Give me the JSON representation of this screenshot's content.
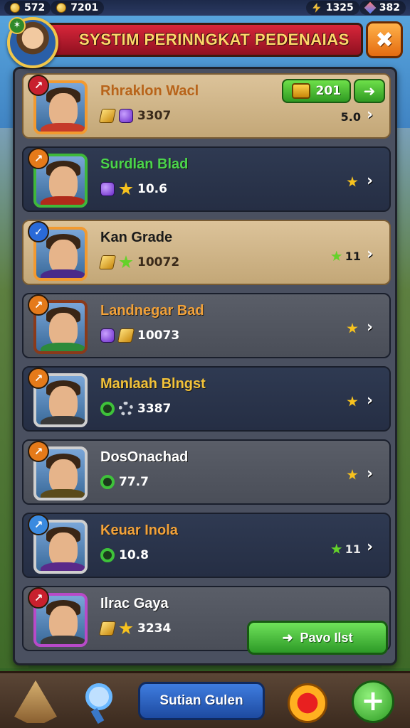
{
  "status_bar": {
    "left_coin_value": "572",
    "coins_value": "7201",
    "bolt_value": "1325",
    "gems_value": "382"
  },
  "header": {
    "title": "SYSTIM PERINNGKAT PEDENAIAS",
    "close_icon": "✖"
  },
  "leaderboard": {
    "top_reward": {
      "value": "201",
      "arrow": "➜"
    },
    "rows": [
      {
        "name": "Rhraklon Wacl",
        "name_color": "#b8641a",
        "stat_value": "3307",
        "right_value": "5.0",
        "style": "gold",
        "badge_color": "#c8202e",
        "frame_color": "#f29a30",
        "body_color": "#c53a2a",
        "badge_glyph": "↗"
      },
      {
        "name": "Surdlan Blad",
        "name_color": "#4bd54b",
        "stat_value": "10.6",
        "right_value": "",
        "style": "dark",
        "badge_color": "#e57a1a",
        "frame_color": "#3fb83a",
        "body_color": "#b02a1a",
        "badge_glyph": "↗"
      },
      {
        "name": "Kan Grade",
        "name_color": "#1a1a1a",
        "stat_value": "10072",
        "right_value": "11",
        "style": "gold",
        "badge_color": "#2a6ad8",
        "frame_color": "#f29a30",
        "body_color": "#4a2a8a",
        "badge_glyph": "✓"
      },
      {
        "name": "Landnegar Bad",
        "name_color": "#f2a23a",
        "stat_value": "10073",
        "right_value": "",
        "style": "grey",
        "badge_color": "#e57a1a",
        "frame_color": "#8a3a1a",
        "body_color": "#2d8a3a",
        "badge_glyph": "↗"
      },
      {
        "name": "Manlaah Blngst",
        "name_color": "#f2c23a",
        "stat_value": "3387",
        "right_value": "",
        "style": "dark",
        "badge_color": "#e57a1a",
        "frame_color": "#cfcfcf",
        "body_color": "#3a3a3a",
        "badge_glyph": "↗"
      },
      {
        "name": "DosOnachad",
        "name_color": "#ffffff",
        "stat_value": "77.7",
        "right_value": "",
        "style": "grey",
        "badge_color": "#e57a1a",
        "frame_color": "#cfcfcf",
        "body_color": "#5a4a1a",
        "badge_glyph": "↗"
      },
      {
        "name": "Keuar Inola",
        "name_color": "#f2a23a",
        "stat_value": "10.8",
        "right_value": "11",
        "style": "dark",
        "badge_color": "#3a8ae0",
        "frame_color": "#cfcfcf",
        "body_color": "#5a2a8a",
        "badge_glyph": "↗"
      },
      {
        "name": "Ilrac Gaya",
        "name_color": "#ffffff",
        "stat_value": "3234",
        "right_value": "",
        "style": "grey",
        "badge_color": "#c8202e",
        "frame_color": "#b84ac8",
        "body_color": "#3a3a3a",
        "badge_glyph": "↗"
      }
    ],
    "cta_label": "Pavo Ilst"
  },
  "bottom_bar": {
    "main_button_label": "Sutian Gulen",
    "plus_label": "+"
  }
}
